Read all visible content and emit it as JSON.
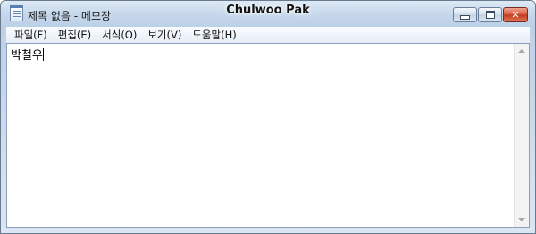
{
  "window": {
    "document_title": "제목 없음 - 메모장",
    "center_title": "Chulwoo Pak"
  },
  "icons": {
    "app": "notepad-icon",
    "minimize": "minimize-icon",
    "maximize": "maximize-icon",
    "close": "close-icon",
    "close_glyph": "✕"
  },
  "menu": {
    "items": [
      {
        "label": "파일(F)"
      },
      {
        "label": "편집(E)"
      },
      {
        "label": "서식(O)"
      },
      {
        "label": "보기(V)"
      },
      {
        "label": "도움말(H)"
      }
    ]
  },
  "editor": {
    "content": "박철우"
  },
  "colors": {
    "close_button": "#c23a1e",
    "title_bar": "#c4d6ea"
  }
}
